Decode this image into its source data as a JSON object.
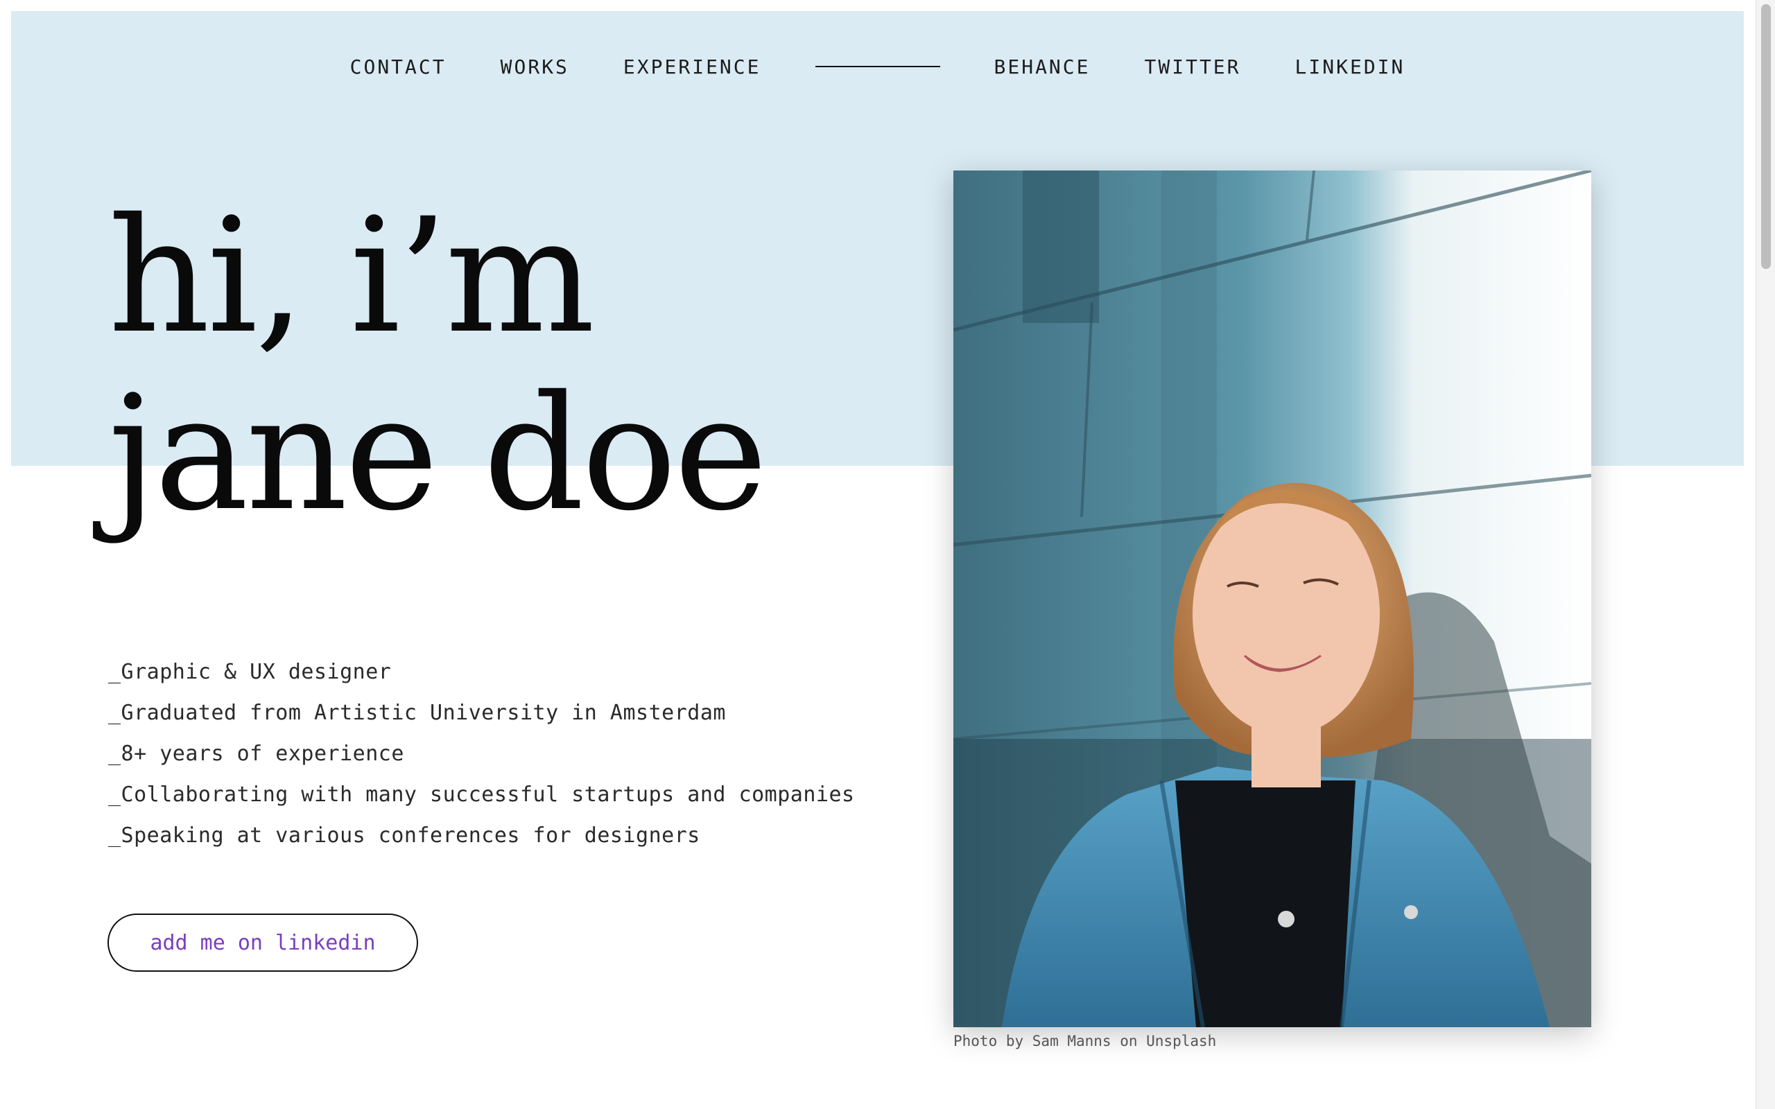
{
  "nav": {
    "left_links": [
      "CONTACT",
      "WORKS",
      "EXPERIENCE"
    ],
    "right_links": [
      "BEHANCE",
      "TWITTER",
      "LINKEDIN"
    ]
  },
  "hero": {
    "title_line1": "hi, i’m",
    "title_line2": "jane doe",
    "bio": [
      "_Graphic & UX designer",
      "_Graduated from Artistic University in Amsterdam",
      "_8+ years of experience",
      "_Collaborating with many successful startups and companies",
      "_Speaking at various conferences for designers"
    ],
    "cta_label": "add me on linkedin"
  },
  "photo": {
    "credit": "Photo by Sam Manns on Unsplash"
  },
  "colors": {
    "hero_band": "#daebf4",
    "cta_text": "#7a3fbf",
    "text": "#1c1c1c"
  }
}
